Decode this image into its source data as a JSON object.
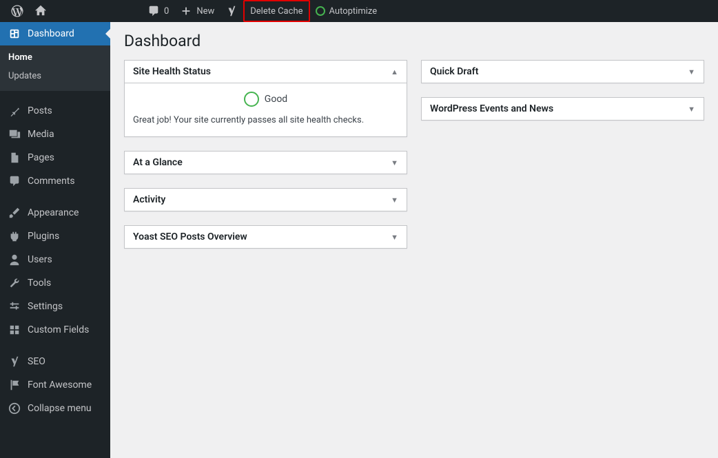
{
  "adminbar": {
    "comments_count": "0",
    "new_label": "New",
    "delete_cache_label": "Delete Cache",
    "autoptimize_label": "Autoptimize"
  },
  "sidebar": {
    "dashboard": "Dashboard",
    "submenu": {
      "home": "Home",
      "updates": "Updates"
    },
    "posts": "Posts",
    "media": "Media",
    "pages": "Pages",
    "comments": "Comments",
    "appearance": "Appearance",
    "plugins": "Plugins",
    "users": "Users",
    "tools": "Tools",
    "settings": "Settings",
    "custom_fields": "Custom Fields",
    "seo": "SEO",
    "font_awesome": "Font Awesome",
    "collapse": "Collapse menu"
  },
  "page": {
    "title": "Dashboard"
  },
  "widgets": {
    "site_health": {
      "title": "Site Health Status",
      "status": "Good",
      "message": "Great job! Your site currently passes all site health checks."
    },
    "at_a_glance": {
      "title": "At a Glance"
    },
    "activity": {
      "title": "Activity"
    },
    "yoast": {
      "title": "Yoast SEO Posts Overview"
    },
    "quick_draft": {
      "title": "Quick Draft"
    },
    "wp_events": {
      "title": "WordPress Events and News"
    }
  }
}
